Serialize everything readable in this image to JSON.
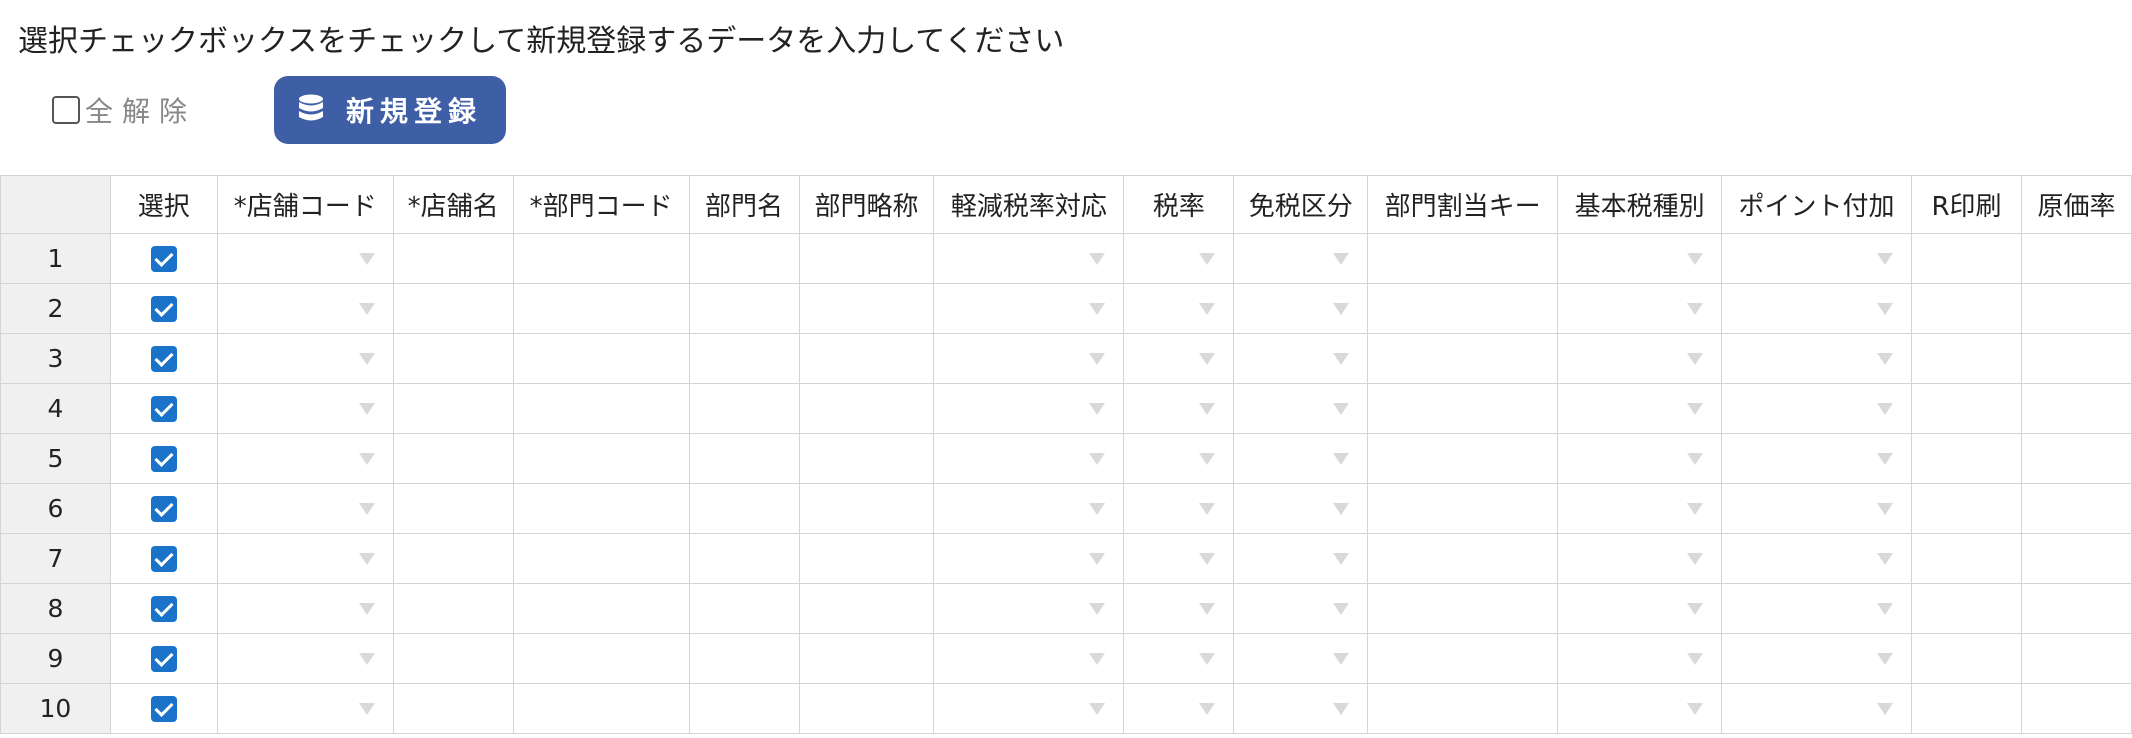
{
  "instruction": "選択チェックボックスをチェックして新規登録するデータを入力してください",
  "toolbar": {
    "deselect_all_label": "全解除",
    "register_label": "新規登録",
    "register_icon": "database-icon"
  },
  "grid": {
    "columns": [
      {
        "label": "",
        "type": "rownum"
      },
      {
        "label": "選択",
        "type": "checkbox"
      },
      {
        "label": "*店舗コード",
        "type": "dropdown"
      },
      {
        "label": "*店舗名",
        "type": "text"
      },
      {
        "label": "*部門コード",
        "type": "text"
      },
      {
        "label": "部門名",
        "type": "text"
      },
      {
        "label": "部門略称",
        "type": "text"
      },
      {
        "label": "軽減税率対応",
        "type": "dropdown"
      },
      {
        "label": "税率",
        "type": "dropdown"
      },
      {
        "label": "免税区分",
        "type": "dropdown"
      },
      {
        "label": "部門割当キー",
        "type": "text"
      },
      {
        "label": "基本税種別",
        "type": "dropdown"
      },
      {
        "label": "ポイント付加",
        "type": "dropdown"
      },
      {
        "label": "R印刷",
        "type": "text"
      },
      {
        "label": "原価率",
        "type": "text"
      }
    ],
    "rows": [
      {
        "num": "1",
        "selected": true
      },
      {
        "num": "2",
        "selected": true
      },
      {
        "num": "3",
        "selected": true
      },
      {
        "num": "4",
        "selected": true
      },
      {
        "num": "5",
        "selected": true
      },
      {
        "num": "6",
        "selected": true
      },
      {
        "num": "7",
        "selected": true
      },
      {
        "num": "8",
        "selected": true
      },
      {
        "num": "9",
        "selected": true
      },
      {
        "num": "10",
        "selected": true
      }
    ]
  },
  "colors": {
    "accent": "#3e5ea6",
    "checkbox": "#1a73c9",
    "header_bg": "#f0f0f0",
    "border": "#d4d4d4"
  }
}
